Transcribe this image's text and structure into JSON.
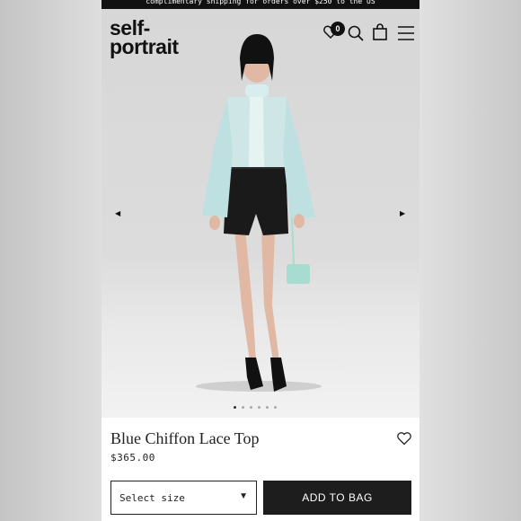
{
  "promo_banner": {
    "text": "complimentary shipping for orders over $250 to the US"
  },
  "header": {
    "logo_line1": "self-",
    "logo_line2": "portrait",
    "wishlist_count": "0",
    "icons": [
      "heart-icon",
      "search-icon",
      "bag-icon",
      "menu-icon"
    ]
  },
  "gallery": {
    "prev_arrow": "◀",
    "next_arrow": "▶",
    "dot_count": 6,
    "active_dot": 1
  },
  "product": {
    "name": "Blue Chiffon Lace Top",
    "price": "$365.00",
    "size_select_label": "Select size",
    "size_caret": "▼",
    "add_to_bag_label": "ADD TO BAG"
  }
}
